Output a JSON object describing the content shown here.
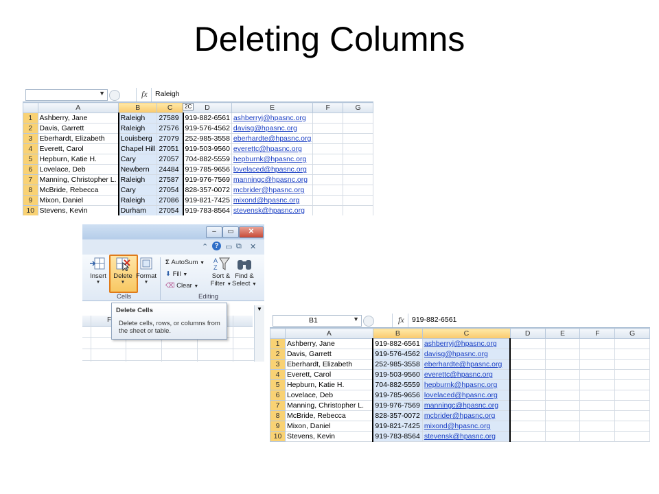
{
  "slide": {
    "title": "Deleting Columns"
  },
  "sheet1": {
    "namebox": "",
    "formula": "Raleigh",
    "col_headers": [
      "A",
      "B",
      "C",
      "D",
      "E",
      "F",
      "G"
    ],
    "col_tooltip": "2C",
    "rows": [
      [
        "1",
        "Ashberry, Jane",
        "Raleigh",
        "27589",
        "919-882-6561",
        "ashberryj@hpasnc.org"
      ],
      [
        "2",
        "Davis, Garrett",
        "Raleigh",
        "27576",
        "919-576-4562",
        "davisg@hpasnc.org"
      ],
      [
        "3",
        "Eberhardt, Elizabeth",
        "Louisberg",
        "27079",
        "252-985-3558",
        "eberhardte@hpasnc.org"
      ],
      [
        "4",
        "Everett, Carol",
        "Chapel Hill",
        "27051",
        "919-503-9560",
        "everettc@hpasnc.org"
      ],
      [
        "5",
        "Hepburn, Katie H.",
        "Cary",
        "27057",
        "704-882-5559",
        "hepburnk@hpasnc.org"
      ],
      [
        "6",
        "Lovelace, Deb",
        "Newbern",
        "24484",
        "919-785-9656",
        "lovelaced@hpasnc.org"
      ],
      [
        "7",
        "Manning, Christopher L.",
        "Raleigh",
        "27587",
        "919-976-7569",
        "manningc@hpasnc.org"
      ],
      [
        "8",
        "McBride, Rebecca",
        "Cary",
        "27054",
        "828-357-0072",
        "mcbrider@hpasnc.org"
      ],
      [
        "9",
        "Mixon, Daniel",
        "Raleigh",
        "27086",
        "919-821-7425",
        "mixond@hpasnc.org"
      ],
      [
        "10",
        "Stevens, Kevin",
        "Durham",
        "27054",
        "919-783-8564",
        "stevensk@hpasnc.org"
      ]
    ]
  },
  "ribbon": {
    "buttons": {
      "insert": "Insert",
      "delete": "Delete",
      "format": "Format"
    },
    "autosum": "AutoSum",
    "fill": "Fill",
    "clear": "Clear",
    "sort_filter": [
      "Sort &",
      "Filter"
    ],
    "find_select": [
      "Find &",
      "Select"
    ],
    "group_cells": "Cells",
    "group_editing": "Editing",
    "tooltip": {
      "title": "Delete Cells",
      "desc": "Delete cells, rows, or columns from the sheet or table."
    },
    "under_col": "F"
  },
  "sheet2": {
    "namebox": "B1",
    "formula": "919-882-6561",
    "col_headers": [
      "A",
      "B",
      "C",
      "D",
      "E",
      "F",
      "G"
    ],
    "rows": [
      [
        "1",
        "Ashberry, Jane",
        "919-882-6561",
        "ashberryj@hpasnc.org"
      ],
      [
        "2",
        "Davis, Garrett",
        "919-576-4562",
        "davisg@hpasnc.org"
      ],
      [
        "3",
        "Eberhardt, Elizabeth",
        "252-985-3558",
        "eberhardte@hpasnc.org"
      ],
      [
        "4",
        "Everett, Carol",
        "919-503-9560",
        "everettc@hpasnc.org"
      ],
      [
        "5",
        "Hepburn, Katie H.",
        "704-882-5559",
        "hepburnk@hpasnc.org"
      ],
      [
        "6",
        "Lovelace, Deb",
        "919-785-9656",
        "lovelaced@hpasnc.org"
      ],
      [
        "7",
        "Manning, Christopher L.",
        "919-976-7569",
        "manningc@hpasnc.org"
      ],
      [
        "8",
        "McBride, Rebecca",
        "828-357-0072",
        "mcbrider@hpasnc.org"
      ],
      [
        "9",
        "Mixon, Daniel",
        "919-821-7425",
        "mixond@hpasnc.org"
      ],
      [
        "10",
        "Stevens, Kevin",
        "919-783-8564",
        "stevensk@hpasnc.org"
      ]
    ]
  },
  "colors": {
    "selection": "#dbe8f8",
    "highlight_border": "#e07b1a",
    "link": "#1a3fc4"
  }
}
